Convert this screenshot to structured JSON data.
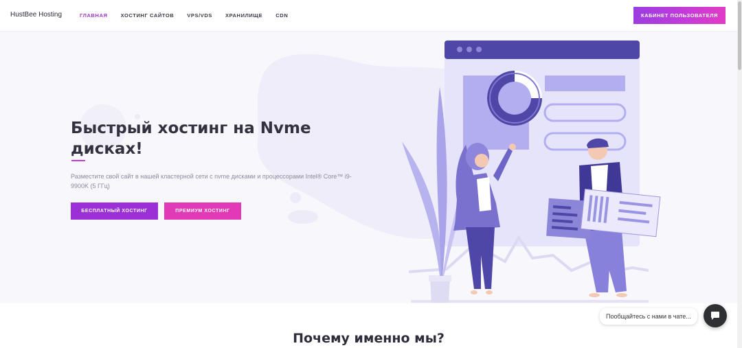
{
  "header": {
    "logo": "HustBee Hosting",
    "nav": [
      {
        "label": "ГЛАВНАЯ",
        "active": true
      },
      {
        "label": "ХОСТИНГ САЙТОВ",
        "active": false
      },
      {
        "label": "VPS/VDS",
        "active": false
      },
      {
        "label": "ХРАНИЛИЩЕ",
        "active": false
      },
      {
        "label": "CDN",
        "active": false
      }
    ],
    "cabinet_button": "КАБИНЕТ ПОЛЬЗОВАТЕЛЯ"
  },
  "hero": {
    "title": "Быстрый хостинг на Nvme дисках!",
    "subtitle": "Разместите свой сайт в нашей кластерной сети с nvme дисками и процессорами Intel® Core™ i9-9900K (5 ГГц)",
    "free_button": "БЕСПЛАТНЫЙ ХОСТИНГ",
    "premium_button": "ПРЕМИУМ ХОСТИНГ"
  },
  "section": {
    "why_title": "Почему именно мы?"
  },
  "chat": {
    "bubble_text": "Пообщайтесь с нами в чате...",
    "icon": "chat-icon"
  },
  "colors": {
    "accent_purple": "#9a30d6",
    "accent_pink": "#e23ab7",
    "illustration": "#5c55b8"
  }
}
